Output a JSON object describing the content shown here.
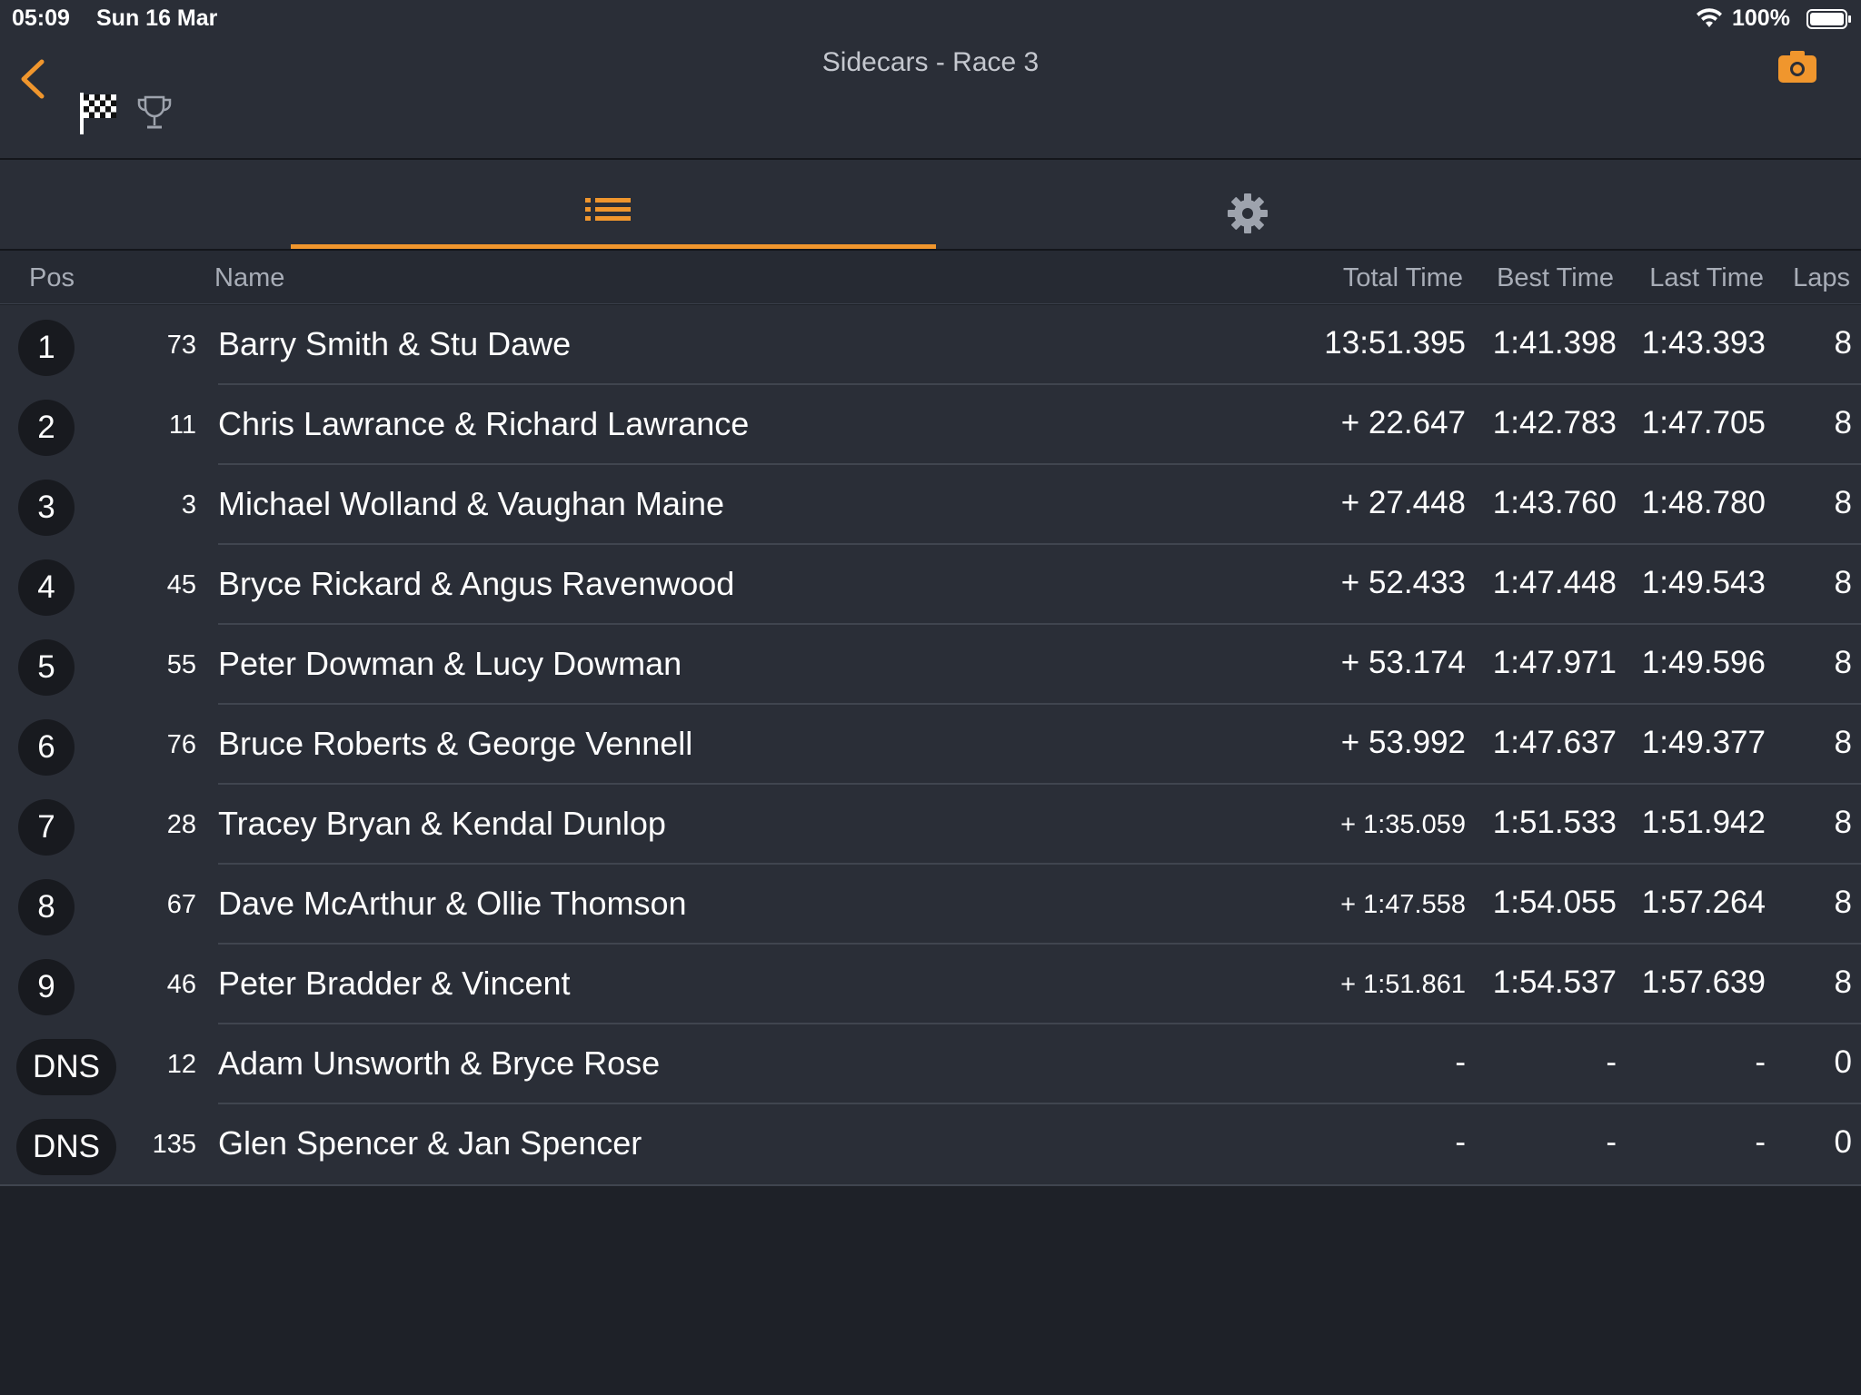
{
  "status": {
    "time": "05:09",
    "date": "Sun 16 Mar",
    "battery": "100%"
  },
  "nav": {
    "title": "Sidecars - Race 3",
    "accent": "#f0962d"
  },
  "tabs": [
    {
      "icon": "list-icon",
      "selected": true
    },
    {
      "icon": "gear-icon",
      "selected": false
    }
  ],
  "table": {
    "headers": {
      "pos": "Pos",
      "name": "Name",
      "total": "Total Time",
      "best": "Best Time",
      "last": "Last Time",
      "laps": "Laps"
    },
    "rows": [
      {
        "pos": "1",
        "num": "73",
        "name": "Barry Smith & Stu Dawe",
        "total": "13:51.395",
        "best": "1:41.398",
        "last": "1:43.393",
        "laps": "8"
      },
      {
        "pos": "2",
        "num": "11",
        "name": "Chris Lawrance & Richard Lawrance",
        "total": "+ 22.647",
        "best": "1:42.783",
        "last": "1:47.705",
        "laps": "8"
      },
      {
        "pos": "3",
        "num": "3",
        "name": "Michael Wolland & Vaughan Maine",
        "total": "+ 27.448",
        "best": "1:43.760",
        "last": "1:48.780",
        "laps": "8"
      },
      {
        "pos": "4",
        "num": "45",
        "name": "Bryce Rickard & Angus Ravenwood",
        "total": "+ 52.433",
        "best": "1:47.448",
        "last": "1:49.543",
        "laps": "8"
      },
      {
        "pos": "5",
        "num": "55",
        "name": "Peter Dowman & Lucy Dowman",
        "total": "+ 53.174",
        "best": "1:47.971",
        "last": "1:49.596",
        "laps": "8"
      },
      {
        "pos": "6",
        "num": "76",
        "name": "Bruce Roberts & George Vennell",
        "total": "+ 53.992",
        "best": "1:47.637",
        "last": "1:49.377",
        "laps": "8"
      },
      {
        "pos": "7",
        "num": "28",
        "name": "Tracey Bryan & Kendal Dunlop",
        "total": "+ 1:35.059",
        "best": "1:51.533",
        "last": "1:51.942",
        "laps": "8"
      },
      {
        "pos": "8",
        "num": "67",
        "name": "Dave McArthur & Ollie Thomson",
        "total": "+ 1:47.558",
        "best": "1:54.055",
        "last": "1:57.264",
        "laps": "8"
      },
      {
        "pos": "9",
        "num": "46",
        "name": "Peter Bradder & Vincent",
        "total": "+ 1:51.861",
        "best": "1:54.537",
        "last": "1:57.639",
        "laps": "8"
      },
      {
        "pos": "DNS",
        "num": "12",
        "name": "Adam Unsworth & Bryce Rose",
        "total": "-",
        "best": "-",
        "last": "-",
        "laps": "0"
      },
      {
        "pos": "DNS",
        "num": "135",
        "name": "Glen Spencer & Jan Spencer",
        "total": "-",
        "best": "-",
        "last": "-",
        "laps": "0"
      }
    ]
  }
}
